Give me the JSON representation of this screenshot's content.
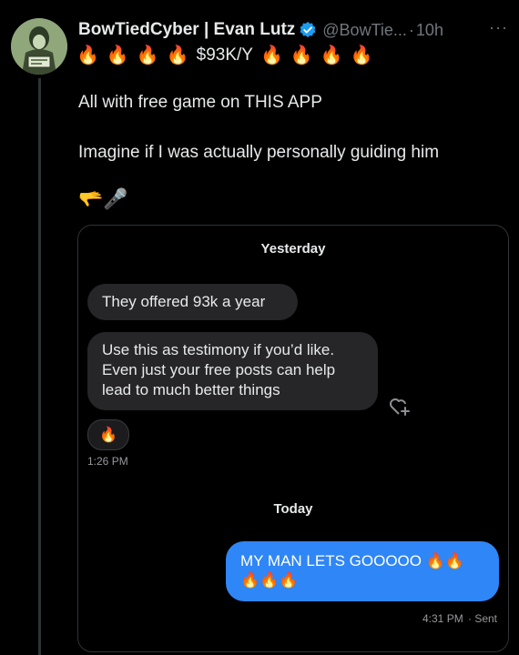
{
  "tweet": {
    "author_name": "BowTiedCyber | Evan Lutz",
    "handle": "@BowTie...",
    "separator": "·",
    "time_ago": "10h",
    "more_label": "···",
    "icons": {
      "verified": "verified-badge-icon",
      "fire": "fire-emoji",
      "pointing": "pointing-hand-emoji",
      "mic": "microphone-emoji",
      "avatar": "avatar"
    },
    "fire_glyph": "🔥",
    "salary_text": "$93K/Y",
    "text_line1": "All with free game on THIS APP",
    "text_line2": "Imagine if I was actually personally guiding him",
    "emoji_line": "🫳🎤",
    "colors": {
      "background": "#000000",
      "verified": "#1d9bf0",
      "muted": "#71767b"
    }
  },
  "conversation": {
    "yesterday_label": "Yesterday",
    "msg1": "They offered 93k a year",
    "msg2": "Use this as testimony if you’d like. Even just your free posts can help lead to much better things",
    "reaction": "🔥",
    "msg2_time": "1:26 PM",
    "today_label": "Today",
    "sent_text": "MY MAN LETS GOOOOO 🔥🔥 🔥🔥🔥",
    "sent_time": "4:31 PM",
    "sent_status": "· Sent",
    "colors": {
      "sent_bubble": "#2f86f6",
      "received_bubble": "#262628"
    }
  }
}
